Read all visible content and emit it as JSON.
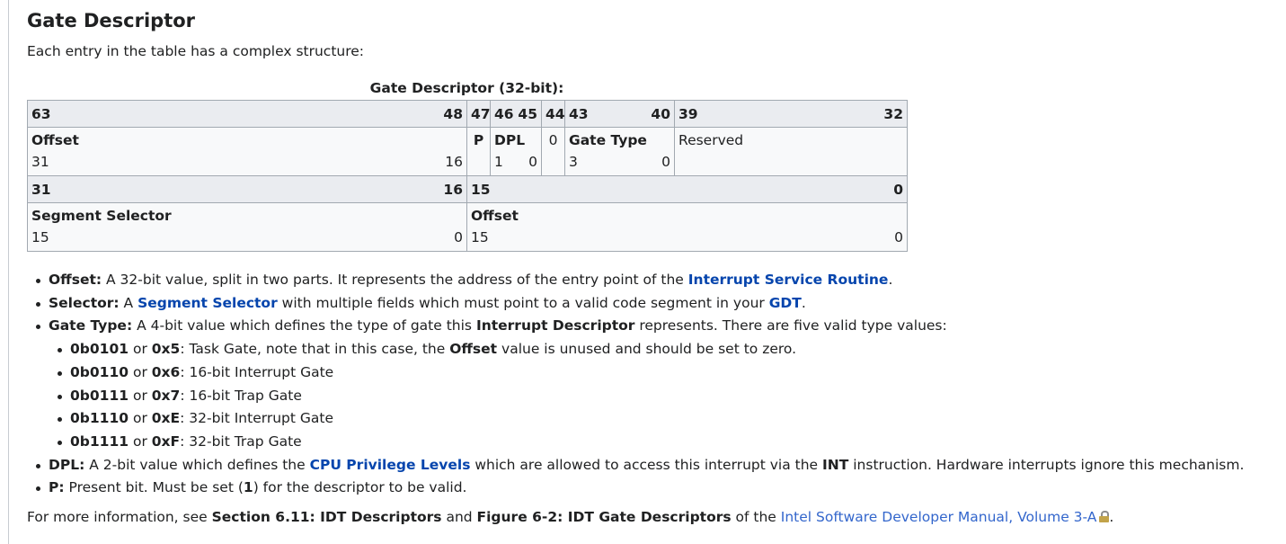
{
  "section": {
    "title": "Gate Descriptor",
    "intro": "Each entry in the table has a complex structure:"
  },
  "table": {
    "caption": "Gate Descriptor (32-bit):",
    "row1_header": {
      "c1_left": "63",
      "c1_right": "48",
      "c2": "47",
      "c3_left": "46",
      "c3_right": "45",
      "c4": "44",
      "c5_left": "43",
      "c5_right": "40",
      "c6_left": "39",
      "c6_right": "32"
    },
    "row1_fields": {
      "offset_name": "Offset",
      "offset_hi": "31",
      "offset_lo": "16",
      "p_name": "P",
      "dpl_name": "DPL",
      "dpl_hi": "1",
      "dpl_lo": "0",
      "zero_name": "0",
      "gatetype_name": "Gate Type",
      "gatetype_hi": "3",
      "gatetype_lo": "0",
      "reserved_name": "Reserved"
    },
    "row2_header": {
      "c1_left": "31",
      "c1_right": "16",
      "c2_left": "15",
      "c2_right": "0"
    },
    "row2_fields": {
      "selector_name": "Segment Selector",
      "selector_hi": "15",
      "selector_lo": "0",
      "offset_name": "Offset",
      "offset_hi": "15",
      "offset_lo": "0"
    }
  },
  "bullets": {
    "offset": {
      "term": "Offset:",
      "text": " A 32-bit value, split in two parts. It represents the address of the entry point of the ",
      "link": "Interrupt Service Routine",
      "tail": "."
    },
    "selector": {
      "term": "Selector:",
      "text1": " A ",
      "link1": "Segment Selector",
      "text2": " with multiple fields which must point to a valid code segment in your ",
      "link2": "GDT",
      "tail": "."
    },
    "gate_type": {
      "term": "Gate Type:",
      "text1": " A 4-bit value which defines the type of gate this ",
      "bold": "Interrupt Descriptor",
      "text2": " represents. There are five valid type values:"
    },
    "types": [
      {
        "bin": "0b0101",
        "or": " or ",
        "hex": "0x5",
        "desc": ": Task Gate, note that in this case, the ",
        "bold": "Offset",
        "desc2": " value is unused and should be set to zero."
      },
      {
        "bin": "0b0110",
        "or": " or ",
        "hex": "0x6",
        "desc": ": 16-bit Interrupt Gate"
      },
      {
        "bin": "0b0111",
        "or": " or ",
        "hex": "0x7",
        "desc": ": 16-bit Trap Gate"
      },
      {
        "bin": "0b1110",
        "or": " or ",
        "hex": "0xE",
        "desc": ": 32-bit Interrupt Gate"
      },
      {
        "bin": "0b1111",
        "or": " or ",
        "hex": "0xF",
        "desc": ": 32-bit Trap Gate"
      }
    ],
    "dpl": {
      "term": "DPL:",
      "text1": " A 2-bit value which defines the ",
      "link": "CPU Privilege Levels",
      "text2": " which are allowed to access this interrupt via the ",
      "bold": "INT",
      "text3": " instruction. Hardware interrupts ignore this mechanism."
    },
    "p": {
      "term": "P:",
      "text1": " Present bit. Must be set (",
      "bold": "1",
      "text2": ") for the descriptor to be valid."
    }
  },
  "footer": {
    "text1": "For more information, see ",
    "bold1": "Section 6.11: IDT Descriptors",
    "text2": " and ",
    "bold2": "Figure 6-2: IDT Gate Descriptors",
    "text3": " of the ",
    "link": "Intel Software Developer Manual, Volume 3-A",
    "tail": ".",
    "lock_icon": "lock-icon"
  }
}
